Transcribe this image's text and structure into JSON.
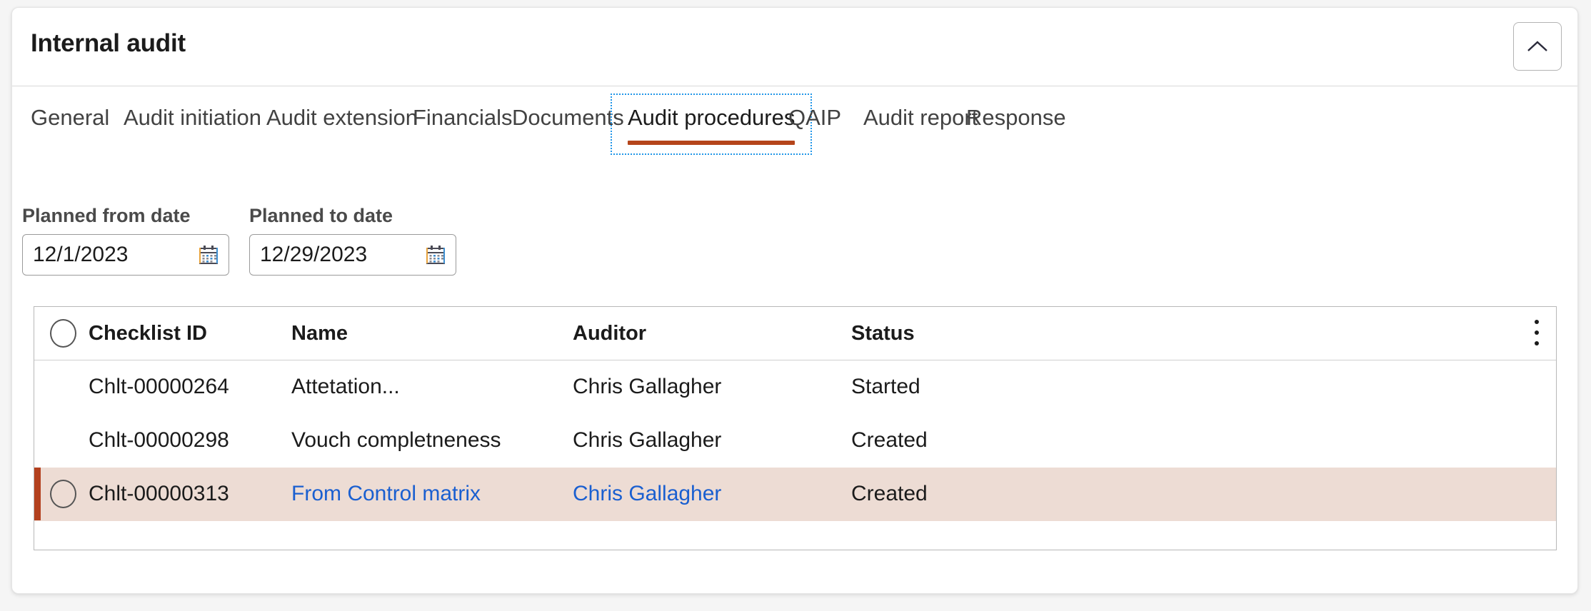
{
  "header": {
    "title": "Internal audit",
    "collapse_icon": "chevron-up-icon"
  },
  "tabs": [
    {
      "label": "General",
      "selected": false
    },
    {
      "label": "Audit initiation",
      "selected": false
    },
    {
      "label": "Audit extension",
      "selected": false
    },
    {
      "label": "Financials",
      "selected": false
    },
    {
      "label": "Documents",
      "selected": false
    },
    {
      "label": "Audit procedures",
      "selected": true
    },
    {
      "label": "QAIP",
      "selected": false
    },
    {
      "label": "Audit report",
      "selected": false
    },
    {
      "label": "Response",
      "selected": false
    }
  ],
  "fields": [
    {
      "label": "Planned from date",
      "value": "12/1/2023",
      "icon": "calendar-icon"
    },
    {
      "label": "Planned to date",
      "value": "12/29/2023",
      "icon": "calendar-icon"
    }
  ],
  "grid": {
    "columns": [
      "Checklist ID",
      "Name",
      "Auditor",
      "Status"
    ],
    "overflow_icon": "kebab-menu-icon",
    "rows": [
      {
        "checklist_id": "Chlt-00000264",
        "name": "Attetation...",
        "auditor": "Chris Gallagher",
        "status": "Started",
        "selected": false,
        "link": false
      },
      {
        "checklist_id": "Chlt-00000298",
        "name": "Vouch completneness",
        "auditor": "Chris Gallagher",
        "status": "Created",
        "selected": false,
        "link": false
      },
      {
        "checklist_id": "Chlt-00000313",
        "name": "From Control matrix",
        "auditor": "Chris Gallagher",
        "status": "Created",
        "selected": true,
        "link": true
      }
    ]
  },
  "colors": {
    "accent": "#b5451b",
    "selected_row_bg": "#eddcd4",
    "selected_row_marker": "#b3401e",
    "focus_outline": "#2196e8",
    "link": "#1a5fd0"
  }
}
